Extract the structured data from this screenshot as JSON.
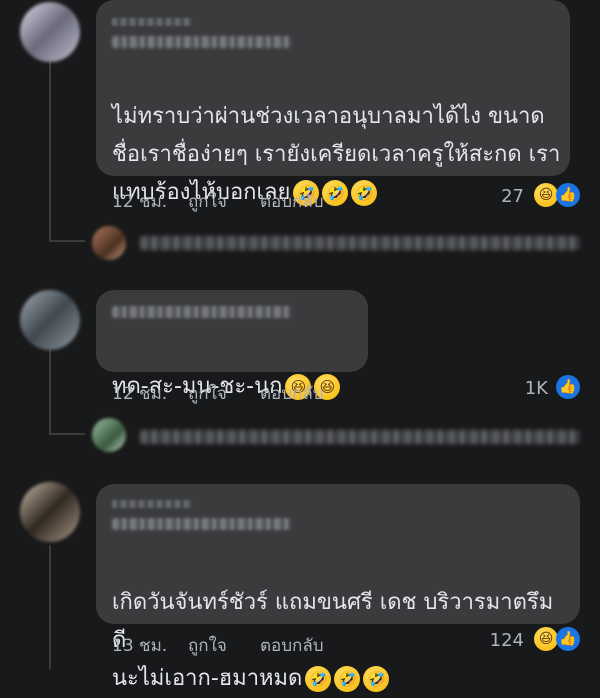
{
  "comments": [
    {
      "text": "ไม่ทราบว่าผ่านช่วงเวลาอนุบาลมาได้ไง  ขนาด\nชื่อเราชื่อง่ายๆ เรายังเครียดเวลาครูให้สะกด เรา\nแทบร้องไห้บอกเลย",
      "emojis": [
        "🤣",
        "🤣",
        "🤣"
      ],
      "time": "12 ชม.",
      "like_label": "ถูกใจ",
      "reply_label": "ตอบกลับ",
      "reaction_count": "27",
      "reaction_icons": [
        "haha-icon",
        "like-icon"
      ]
    },
    {
      "text": "ทด-สะ-มน-ชะ-นก",
      "emojis": [
        "😆",
        "😆"
      ],
      "time": "12 ชม.",
      "like_label": "ถูกใจ",
      "reply_label": "ตอบกลับ",
      "reaction_count": "1K",
      "reaction_icons": [
        "like-icon"
      ]
    },
    {
      "text": "เกิดวันจันทร์ชัวร์ แถมขนศรี เดช บริวารมาตรึม ดี\nนะไม่เอาก-ฮมาหมด",
      "emojis": [
        "🤣",
        "🤣",
        "🤣"
      ],
      "time": "13 ชม.",
      "like_label": "ถูกใจ",
      "reply_label": "ตอบกลับ",
      "reaction_count": "124",
      "reaction_icons": [
        "haha-icon",
        "like-icon"
      ]
    }
  ],
  "colors": {
    "background": "#18191a",
    "bubble": "#3a3b3c",
    "text": "#e4e6eb",
    "meta": "#b0b3b8",
    "like_blue": "#1b74e4"
  }
}
